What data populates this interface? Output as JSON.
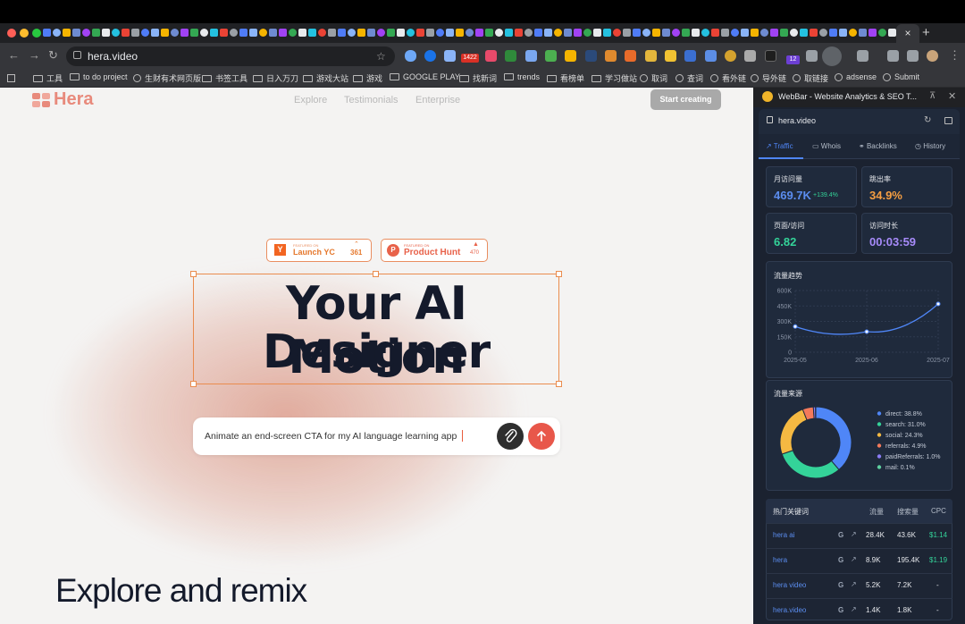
{
  "colors": {
    "accent": "#e8574a",
    "brand": "#e88a7c",
    "panel_bg": "#1b2230",
    "tab_active": "#4f7cf7"
  },
  "browser": {
    "url": "hera.video",
    "active_tab_close": "×",
    "new_tab": "+",
    "ext_badge_count": "1422",
    "ext_badge_12": "12",
    "bookmarks": [
      "工具",
      "to do project",
      "生财有术网页版",
      "书签工具",
      "日入万刀",
      "游戏大站",
      "游戏",
      "GOOGLE PLAY",
      "找新词",
      "trends",
      "看榜单",
      "学习做站",
      "取词",
      "查词",
      "看外链",
      "导外链",
      "取链接",
      "adsense",
      "Submit"
    ]
  },
  "site": {
    "brand": "Hera",
    "nav": [
      "Explore",
      "Testimonials",
      "Enterprise"
    ],
    "cta": "Start creating",
    "badge_yc": {
      "featured": "FEATURED ON",
      "name": "Launch YC",
      "count": "361"
    },
    "badge_ph": {
      "featured": "FEATURED ON",
      "name": "Product Hunt",
      "count": "470"
    },
    "hero_line1": "Your AI Motion",
    "hero_line2": "Designer",
    "prompt": "Animate an end-screen CTA for my AI language learning app",
    "explore_heading": "Explore and remix"
  },
  "panel": {
    "title": "WebBar - Website Analytics & SEO T...",
    "domain": "hera.video",
    "tabs": [
      "Traffic",
      "Whois",
      "Backlinks",
      "History"
    ],
    "stats": [
      {
        "label": "月访问量",
        "value": "469.7K",
        "delta": "+139.4%",
        "color": "#5b8def"
      },
      {
        "label": "跳出率",
        "value": "34.9%",
        "color": "#f59e42"
      },
      {
        "label": "页面/访问",
        "value": "6.82",
        "color": "#34d399"
      },
      {
        "label": "访问时长",
        "value": "00:03:59",
        "color": "#a78bfa"
      }
    ],
    "trend_title": "流量趋势",
    "sources_title": "流量来源",
    "keywords_title": "热门关键词",
    "kw_headers": [
      "流量",
      "搜索量",
      "CPC"
    ],
    "keywords": [
      {
        "kw": "hera ai",
        "traffic": "28.4K",
        "volume": "43.6K",
        "cpc": "$1.14"
      },
      {
        "kw": "hera",
        "traffic": "8.9K",
        "volume": "195.4K",
        "cpc": "$1.19"
      },
      {
        "kw": "hera video",
        "traffic": "5.2K",
        "volume": "7.2K",
        "cpc": "-"
      },
      {
        "kw": "hera.video",
        "traffic": "1.4K",
        "volume": "1.8K",
        "cpc": "-"
      }
    ]
  },
  "chart_data": [
    {
      "type": "line",
      "title": "流量趋势",
      "x": [
        "2025-05",
        "2025-06",
        "2025-07"
      ],
      "values": [
        250000,
        200000,
        470000
      ],
      "yticks": [
        "600K",
        "450K",
        "300K",
        "150K",
        "0"
      ],
      "ylim": [
        0,
        600000
      ]
    },
    {
      "type": "pie",
      "title": "流量来源",
      "labels": [
        "direct: 38.8%",
        "search: 31.0%",
        "social: 24.3%",
        "referrals: 4.9%",
        "paidReferrals: 1.0%",
        "mail: 0.1%"
      ],
      "values": [
        38.8,
        31.0,
        24.3,
        4.9,
        1.0,
        0.1
      ],
      "colors": [
        "#4f86f7",
        "#34d399",
        "#f5b942",
        "#f47a5b",
        "#8b7cf6",
        "#5ed0a0"
      ]
    }
  ]
}
